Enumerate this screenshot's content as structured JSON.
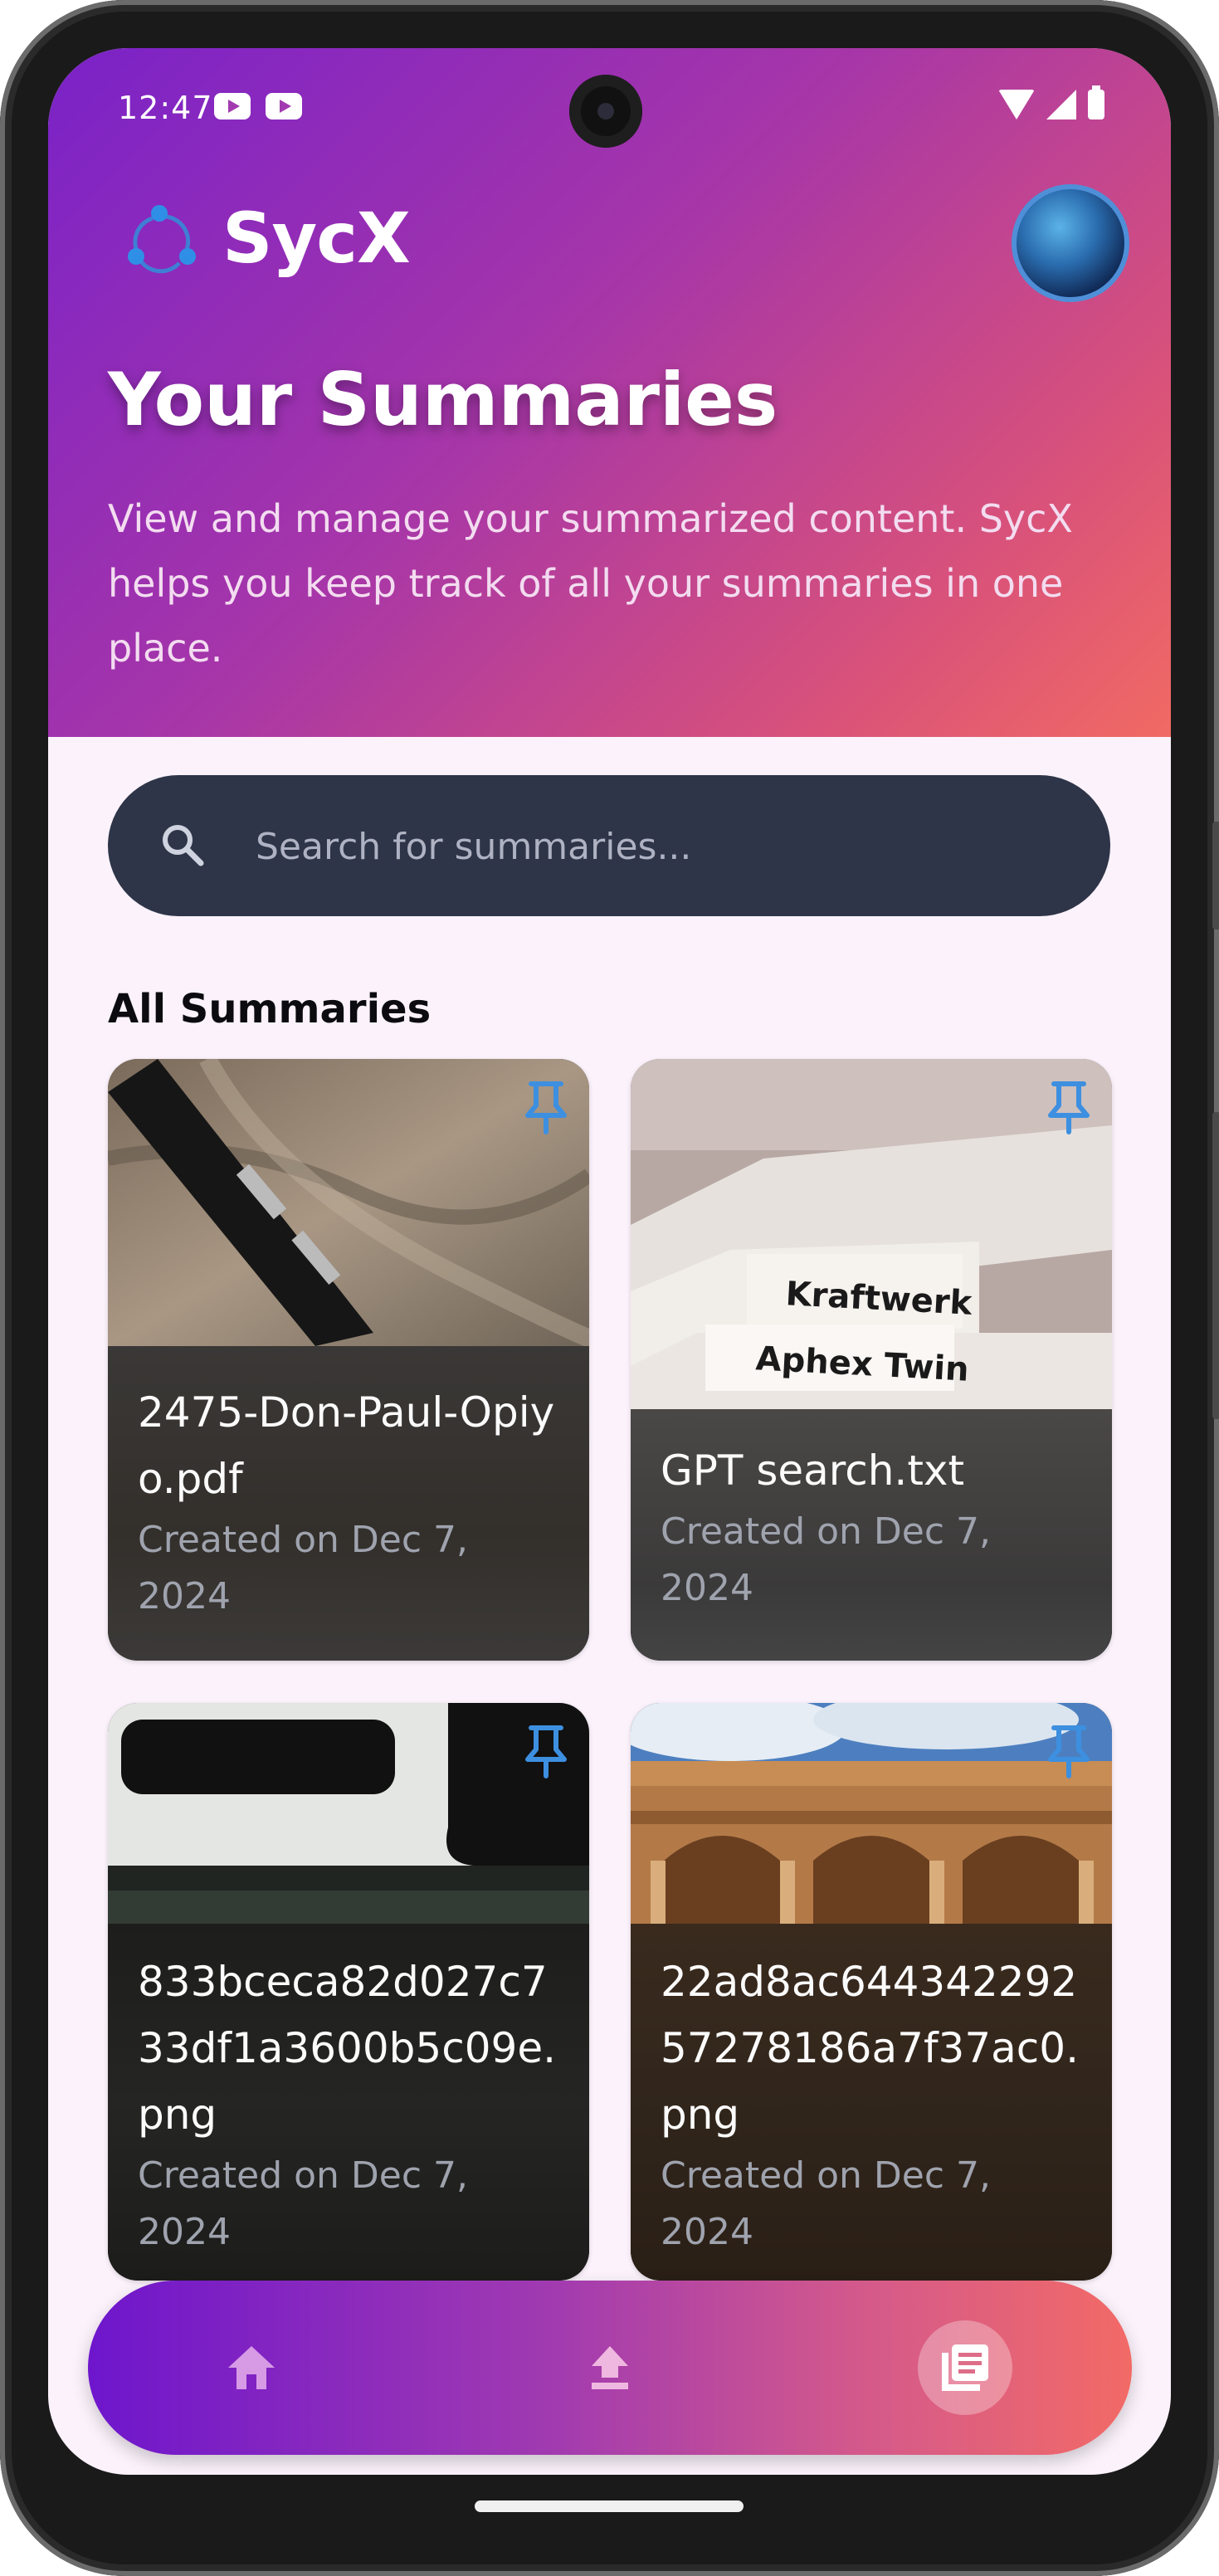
{
  "status_bar": {
    "time": "12:47"
  },
  "app": {
    "name": "SycX"
  },
  "header": {
    "title": "Your Summaries",
    "description": "View and manage your summarized content. SycX helps you keep track of all your summaries in one place."
  },
  "search": {
    "placeholder": "Search for summaries..."
  },
  "section": {
    "title": "All Summaries"
  },
  "summaries": [
    {
      "title": "2475-Don-Paul-Opiyo.pdf",
      "date": "Created on Dec 7, 2024",
      "image": "fountain-pen-photo"
    },
    {
      "title": "GPT search.txt",
      "date": "Created on Dec 7, 2024",
      "image": "file-folders-photo"
    },
    {
      "title": "833bceca82d027c733df1a3600b5c09e.png",
      "date": "Created on Dec 7, 2024",
      "image": "car-window-photo"
    },
    {
      "title": "22ad8ac64434229257278186a7f37ac0.png",
      "date": "Created on Dec 7, 2024",
      "image": "building-photo"
    }
  ],
  "nav": {
    "items": [
      "home-icon",
      "upload-icon",
      "summaries-icon"
    ],
    "active": "summaries-icon"
  },
  "colors": {
    "accent_start": "#7a22c8",
    "accent_end": "#f16a63",
    "search_bg": "#2e3548",
    "pin": "#3d8fe0"
  }
}
